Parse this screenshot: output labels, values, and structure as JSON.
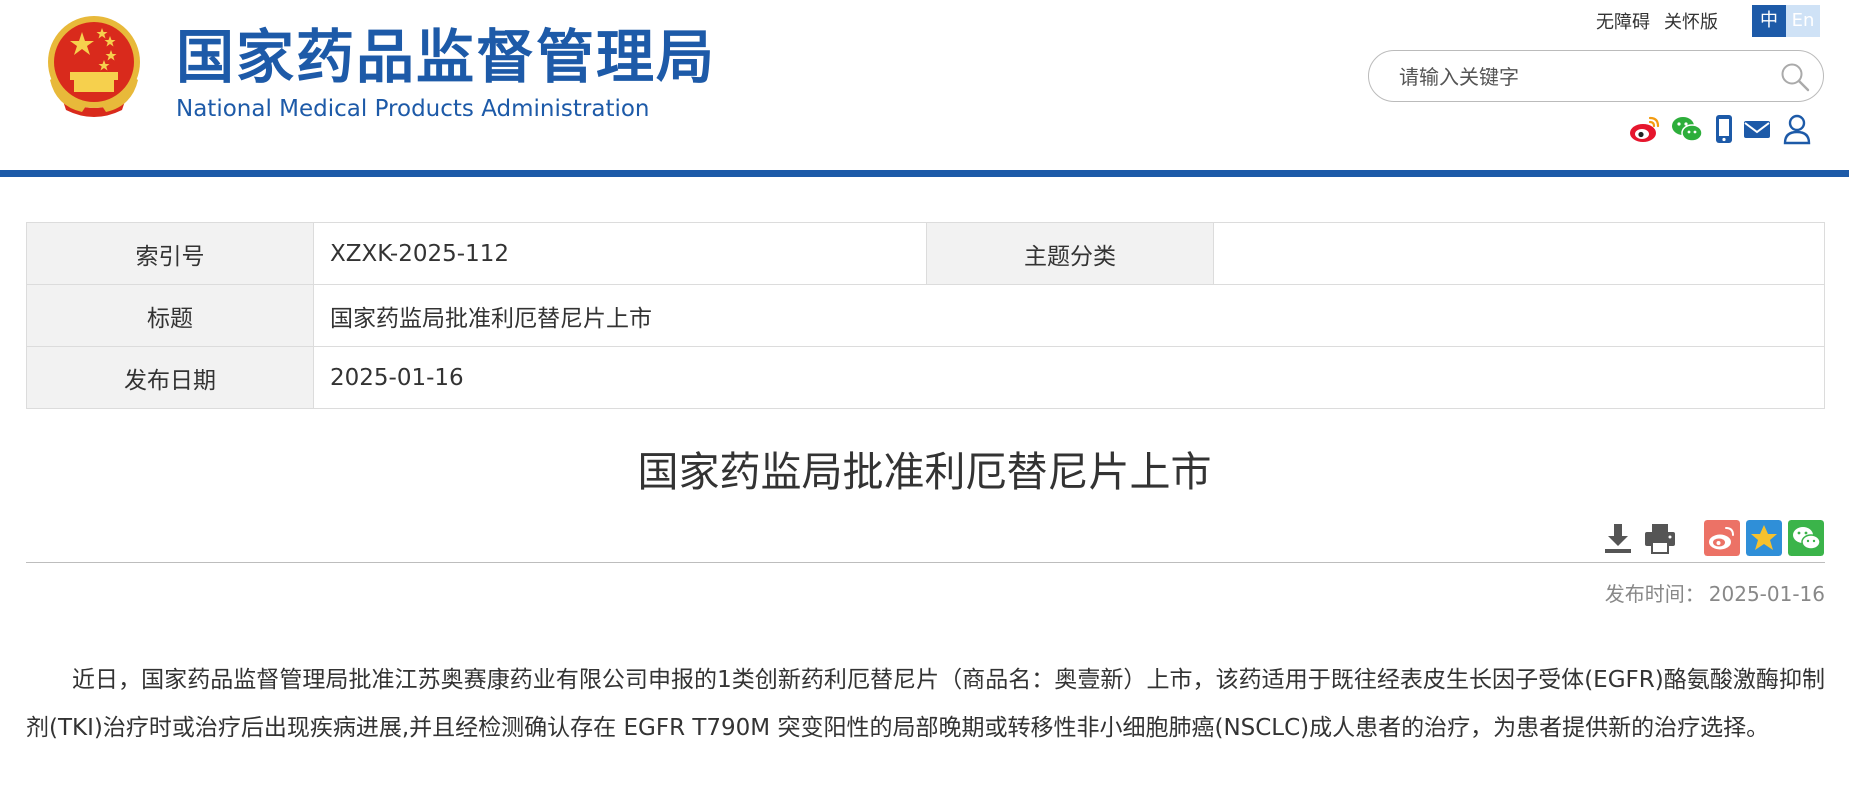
{
  "header": {
    "logo_cn": "国家药品监督管理局",
    "logo_en": "National Medical Products Administration",
    "links": [
      "无障碍",
      "关怀版"
    ],
    "lang_zh": "中",
    "lang_en": "En",
    "search_placeholder": "请输入关键字",
    "social_icons": [
      "weibo-icon",
      "wechat-icon",
      "mobile-icon",
      "email-icon",
      "user-icon"
    ]
  },
  "info_table": {
    "index_label": "索引号",
    "index_value": "XZXK-2025-112",
    "category_label": "主题分类",
    "category_value": "",
    "title_label": "标题",
    "title_value": "国家药监局批准利厄替尼片上市",
    "date_label": "发布日期",
    "date_value": "2025-01-16"
  },
  "article": {
    "title": "国家药监局批准利厄替尼片上市",
    "publish_label": "发布时间：",
    "publish_date": "2025-01-16",
    "body": "近日，国家药品监督管理局批准江苏奥赛康药业有限公司申报的1类创新药利厄替尼片（商品名：奥壹新）上市，该药适用于既往经表皮生长因子受体(EGFR)酪氨酸激酶抑制剂(TKI)治疗时或治疗后出现疾病进展,并且经检测确认存在 EGFR T790M 突变阳性的局部晚期或转移性非小细胞肺癌(NSCLC)成人患者的治疗，为患者提供新的治疗选择。"
  },
  "toolbar": [
    "download-icon",
    "print-icon"
  ],
  "share": [
    "share-weibo-icon",
    "share-qzone-icon",
    "share-wechat-icon"
  ],
  "colors": {
    "brand_blue": "#1d5aa8",
    "weibo_red": "#e8544f",
    "qzone_blue": "#2f8fd8",
    "wechat_green": "#3bb44a"
  }
}
